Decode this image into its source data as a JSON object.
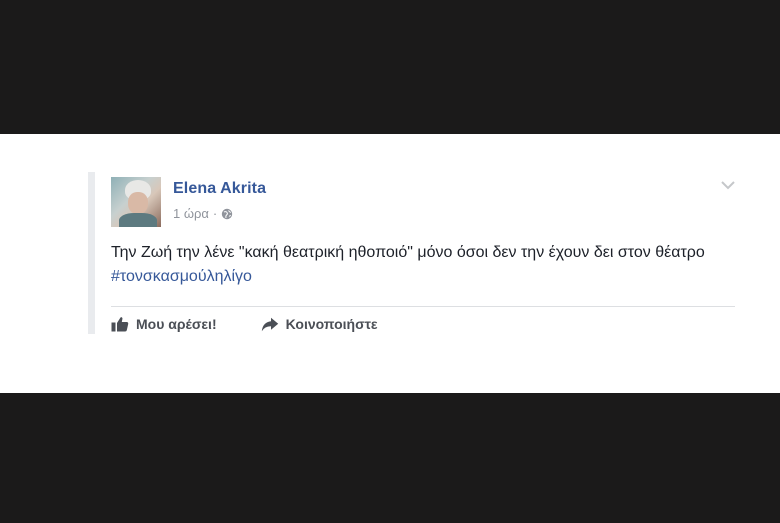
{
  "post": {
    "author": "Elena Akrita",
    "time": "1 ώρα",
    "separator": "·",
    "text_main": "Την Ζωή την λένε \"κακή θεατρική ηθοποιό\" μόνο όσοι δεν την έχουν δει στον θέατρο ",
    "hashtag": "#τονσκασμούληλίγο",
    "privacy_icon": "globe-icon",
    "menu_icon": "chevron-down-icon"
  },
  "actions": {
    "like_label": "Μου αρέσει!",
    "like_icon": "thumbs-up-icon",
    "share_label": "Κοινοποιήστε",
    "share_icon": "share-arrow-icon"
  },
  "colors": {
    "background_band": "#1b1a1a",
    "card": "#ffffff",
    "author": "#365899",
    "hashtag": "#365899",
    "meta": "#90949c",
    "text": "#1d2129",
    "action": "#4b4f56"
  }
}
